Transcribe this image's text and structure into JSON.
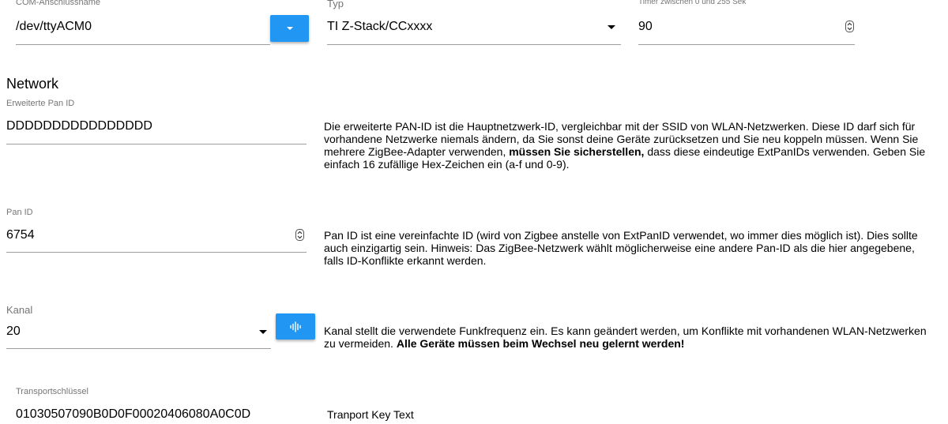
{
  "com": {
    "label": "COM-Anschlussname",
    "value": "/dev/ttyACM0",
    "dropdown_icon": "chevron-down-icon"
  },
  "typ": {
    "label": "Typ",
    "value": "TI Z-Stack/CCxxxx"
  },
  "timer": {
    "label": "Timer zwischen 0 und 255 Sek",
    "value": "90"
  },
  "network": {
    "heading": "Network"
  },
  "ext_pan_id": {
    "label": "Erweiterte Pan ID",
    "value": "DDDDDDDDDDDDDDDD",
    "desc_part1": "Die erweiterte PAN-ID ist die Hauptnetzwerk-ID, vergleichbar mit der SSID von WLAN-Netzwerken. Diese ID darf sich für vorhandene Netzwerke niemals ändern, da Sie sonst deine Geräte zurücksetzen und Sie neu koppeln müssen. Wenn Sie mehrere ZigBee-Adapter verwenden, ",
    "desc_bold": "müssen Sie sicherstellen,",
    "desc_part2": " dass diese eindeutige ExtPanIDs verwenden. Geben Sie einfach 16 zufällige Hex-Zeichen ein (a-f und 0-9)."
  },
  "pan_id": {
    "label": "Pan ID",
    "value": "6754",
    "desc": "Pan ID ist eine vereinfachte ID (wird von Zigbee anstelle von ExtPanID verwendet, wo immer dies möglich ist). Dies sollte auch einzigartig sein. Hinweis: Das ZigBee-Netzwerk wählt möglicherweise eine andere Pan-ID als die hier angegebene, falls ID-Konflikte erkannt werden."
  },
  "kanal": {
    "label": "Kanal",
    "value": "20",
    "scan_icon": "waveform-icon",
    "desc_part1": "Kanal stellt die verwendete Funkfrequenz ein. Es kann geändert werden, um Konflikte mit vorhandenen WLAN-Netzwerken zu vermeiden. ",
    "desc_bold": "Alle Geräte müssen beim Wechsel neu gelernt werden!"
  },
  "transport": {
    "label": "Transportschlüssel",
    "value": "01030507090B0D0F00020406080A0C0D",
    "desc": "Tranport Key Text"
  },
  "colors": {
    "accent": "#2196f3",
    "underline": "#9e9e9e",
    "label": "#757575"
  }
}
